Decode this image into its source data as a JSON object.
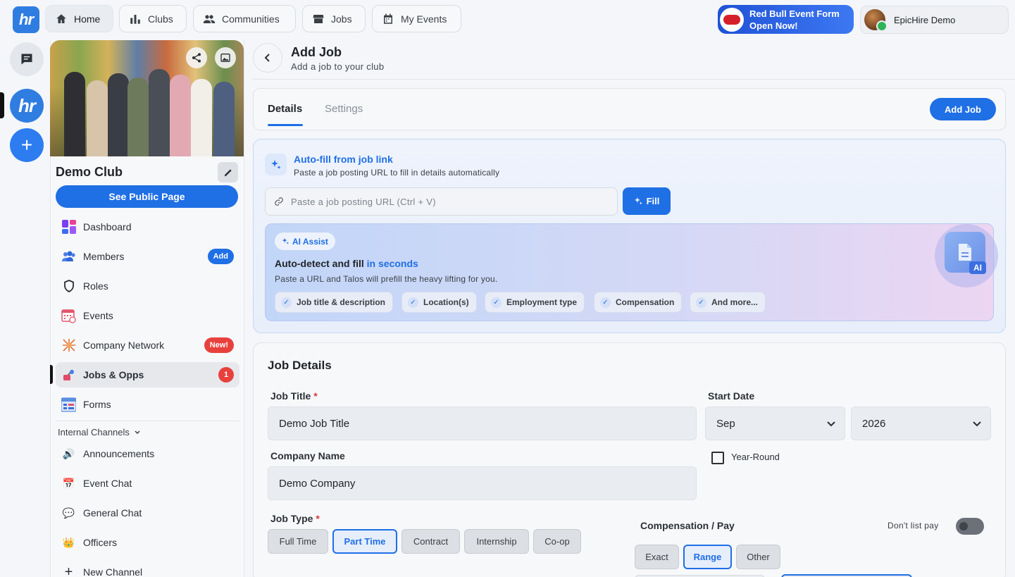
{
  "nav": {
    "logo": "hr",
    "items": [
      {
        "label": "Home",
        "icon": "home-icon"
      },
      {
        "label": "Clubs",
        "icon": "bar-chart-icon"
      },
      {
        "label": "Communities",
        "icon": "people-icon"
      },
      {
        "label": "Jobs",
        "icon": "store-icon"
      },
      {
        "label": "My Events",
        "icon": "calendar-icon"
      }
    ],
    "promo_line1": "Red Bull Event Form",
    "promo_line2": "Open Now!",
    "user_name": "EpicHire Demo"
  },
  "rail": {
    "logo": "hr",
    "add": "+"
  },
  "club": {
    "name": "Demo Club",
    "see_public": "See Public Page",
    "items": [
      {
        "label": "Dashboard",
        "icon": "dashboard-icon"
      },
      {
        "label": "Members",
        "icon": "members-icon",
        "badge": "Add"
      },
      {
        "label": "Roles",
        "icon": "shield-icon"
      },
      {
        "label": "Events",
        "icon": "calendar-icon"
      },
      {
        "label": "Company Network",
        "icon": "network-icon",
        "badge": "New!"
      },
      {
        "label": "Jobs & Opps",
        "icon": "jobs-icon",
        "badge": "1"
      },
      {
        "label": "Forms",
        "icon": "forms-icon"
      }
    ],
    "section": "Internal Channels",
    "channels": [
      {
        "label": "Announcements",
        "icon": "🔊"
      },
      {
        "label": "Event Chat",
        "icon": "📅"
      },
      {
        "label": "General Chat",
        "icon": "💬"
      },
      {
        "label": "Officers",
        "icon": "👑"
      },
      {
        "label": "New Channel",
        "icon": "+"
      }
    ]
  },
  "page": {
    "title": "Add Job",
    "subtitle": "Add a job to your club",
    "tabs": [
      "Details",
      "Settings"
    ],
    "add_job": "Add Job"
  },
  "autofill": {
    "title": "Auto-fill from job link",
    "subtitle": "Paste a job posting URL to fill in details automatically",
    "placeholder": "Paste a job posting URL (Ctrl + V)",
    "fill": "Fill",
    "badge": "AI Assist",
    "headline_a": "Auto-detect and fill ",
    "headline_b": "in seconds",
    "desc": "Paste a URL and Talos will prefill the heavy lifting for you.",
    "chips": [
      "Job title & description",
      "Location(s)",
      "Employment type",
      "Compensation",
      "And more..."
    ],
    "ai_label": "AI"
  },
  "job": {
    "section": "Job Details",
    "title_label": "Job Title",
    "title_value": "Demo Job Title",
    "start_label": "Start Date",
    "month": "Sep",
    "year": "2026",
    "year_round": "Year-Round",
    "company_label": "Company Name",
    "company_value": "Demo Company",
    "type_label": "Job Type",
    "types": [
      "Full Time",
      "Part Time",
      "Contract",
      "Internship",
      "Co-op"
    ],
    "selected_type": "Part Time",
    "comp_label": "Compensation / Pay",
    "dont_list": "Don't list pay",
    "comp_modes": [
      "Exact",
      "Range",
      "Other"
    ],
    "selected_comp": "Range",
    "required_mark": "*"
  },
  "colors": {
    "accent": "#1f6fe5",
    "danger": "#e8413d",
    "logo": "#2f7de1"
  }
}
